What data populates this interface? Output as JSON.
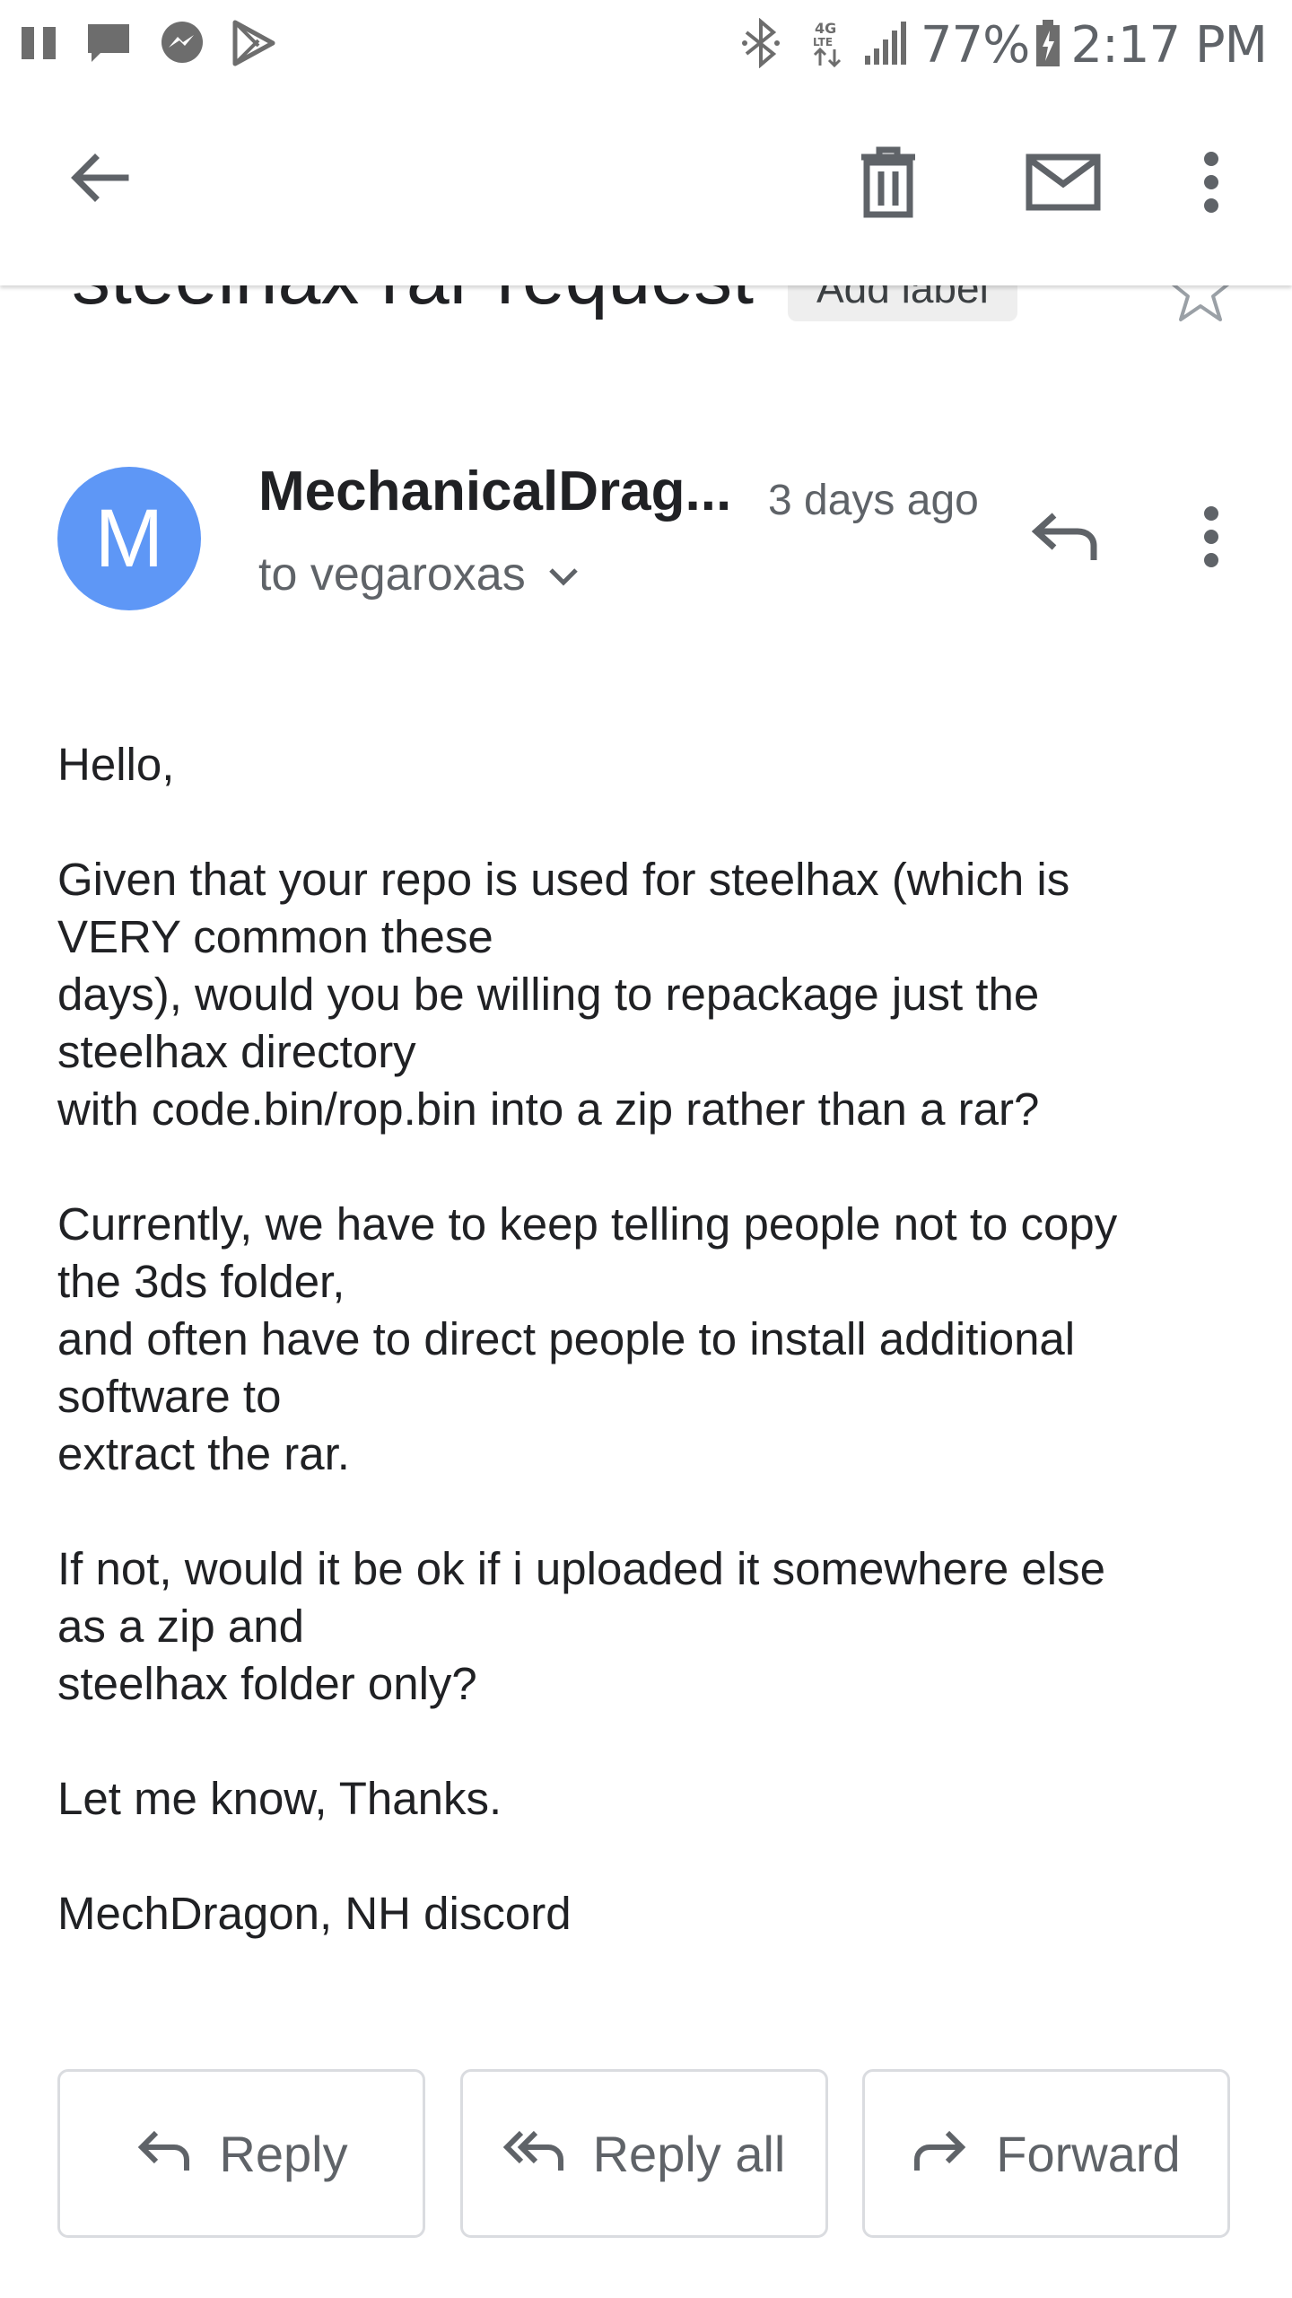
{
  "status_bar": {
    "battery": "77%",
    "time": "2:17 PM",
    "left_icons": [
      "pause-icon",
      "chat-bubble-icon",
      "messenger-icon",
      "play-store-icon"
    ],
    "right_icons": [
      "bluetooth-icon",
      "lte-data-icon",
      "signal-icon",
      "battery-icon"
    ]
  },
  "app_bar": {
    "icons": [
      "back-arrow-icon",
      "delete-icon",
      "mark-unread-icon",
      "more-vert-icon"
    ]
  },
  "email": {
    "subject": "steelhax rar request",
    "add_label": "Add label",
    "sender": {
      "initial": "M",
      "name": "MechanicalDrag...",
      "time": "3 days ago",
      "to": "to vegaroxas",
      "avatar_color": "#5e97f6"
    },
    "body": {
      "greeting": "Hello,",
      "p1": [
        "Given that your repo is used for steelhax (which is",
        "VERY common these",
        "days), would you be willing to repackage just the",
        "steelhax directory",
        "with code.bin/rop.bin into a zip rather than a rar?"
      ],
      "p2": [
        "Currently, we have to keep telling people not to copy",
        "the 3ds folder,",
        "and often have to direct people to install additional",
        "software to",
        "extract the rar."
      ],
      "p3": [
        "If not, would it be ok if i uploaded it somewhere else",
        "as a zip and",
        "steelhax folder only?"
      ],
      "p4": "Let me know, Thanks.",
      "signature": "MechDragon, NH discord"
    }
  },
  "actions": {
    "reply": "Reply",
    "reply_all": "Reply all",
    "forward": "Forward"
  },
  "colors": {
    "icon_gray": "#5f6368",
    "text": "#202124",
    "border": "#dadce0"
  }
}
